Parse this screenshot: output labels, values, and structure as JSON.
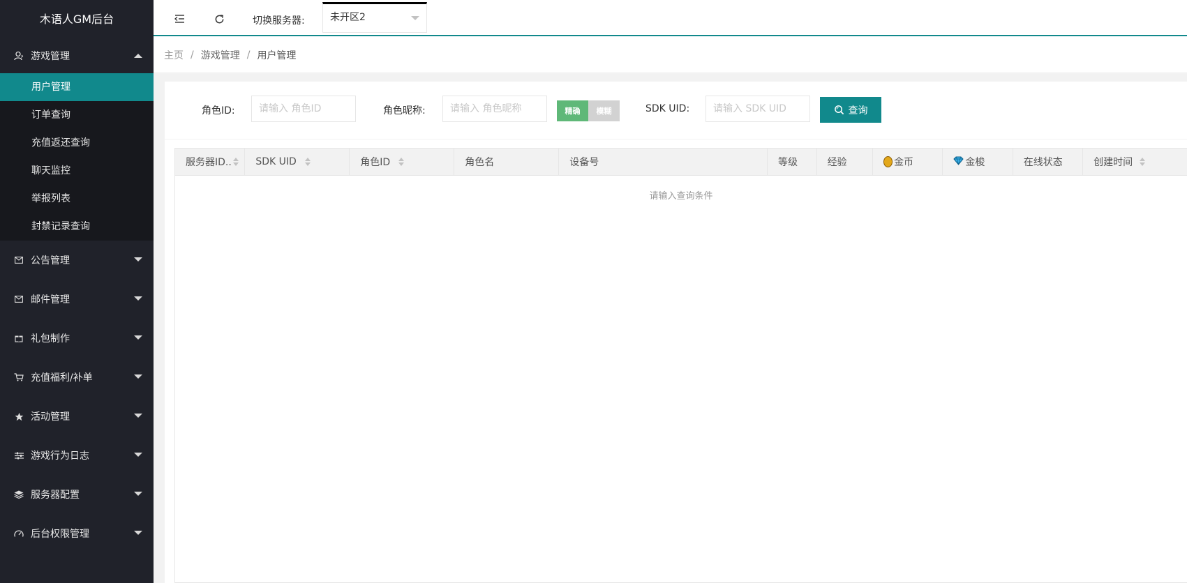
{
  "app": {
    "title": "木语人GM后台"
  },
  "sidebar": {
    "groups": [
      {
        "label": "游戏管理",
        "icon": "user-icon",
        "expanded": true,
        "items": [
          {
            "label": "用户管理",
            "active": true
          },
          {
            "label": "订单查询"
          },
          {
            "label": "充值返还查询"
          },
          {
            "label": "聊天监控"
          },
          {
            "label": "举报列表"
          },
          {
            "label": "封禁记录查询"
          }
        ]
      },
      {
        "label": "公告管理",
        "icon": "mail-icon"
      },
      {
        "label": "邮件管理",
        "icon": "mail-icon"
      },
      {
        "label": "礼包制作",
        "icon": "gift-icon"
      },
      {
        "label": "充值福利/补单",
        "icon": "cart-icon"
      },
      {
        "label": "活动管理",
        "icon": "star-icon"
      },
      {
        "label": "游戏行为日志",
        "icon": "sliders-icon"
      },
      {
        "label": "服务器配置",
        "icon": "layers-icon"
      },
      {
        "label": "后台权限管理",
        "icon": "gauge-icon"
      }
    ]
  },
  "topbar": {
    "server_label": "切换服务器:",
    "server_value": "未开区2"
  },
  "breadcrumb": {
    "home": "主页",
    "section": "游戏管理",
    "page": "用户管理"
  },
  "filter": {
    "role_id_label": "角色ID:",
    "role_id_placeholder": "请输入 角色ID",
    "nickname_label": "角色昵称:",
    "nickname_placeholder": "请输入 角色昵称",
    "match_exact": "精确",
    "match_fuzzy": "模糊",
    "sdk_uid_label": "SDK UID:",
    "sdk_uid_placeholder": "请输入 SDK UID",
    "query_button": "查询"
  },
  "table": {
    "columns": [
      {
        "label": "服务器ID..",
        "sortable": true
      },
      {
        "label": "SDK UID",
        "sortable": true
      },
      {
        "label": "角色ID",
        "sortable": true
      },
      {
        "label": "角色名",
        "sortable": false
      },
      {
        "label": "设备号",
        "sortable": false
      },
      {
        "label": "等级",
        "sortable": false
      },
      {
        "label": "经验",
        "sortable": false
      },
      {
        "label": "金币",
        "sortable": false,
        "icon": "gold-medal-icon"
      },
      {
        "label": "金梭",
        "sortable": false,
        "icon": "diamond-icon"
      },
      {
        "label": "在线状态",
        "sortable": false
      },
      {
        "label": "创建时间",
        "sortable": true
      }
    ],
    "empty_text": "请输入查询条件"
  },
  "colors": {
    "sidebar_bg": "#20222a",
    "accent": "#11898c",
    "exact_toggle": "#5fb878"
  }
}
